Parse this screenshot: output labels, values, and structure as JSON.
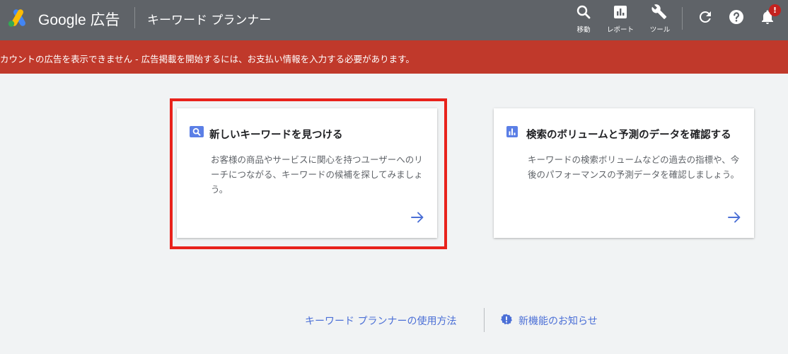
{
  "header": {
    "brand": "Google 広告",
    "page_title": "キーワード プランナー",
    "tools": [
      {
        "label": "移動",
        "icon": "search-icon"
      },
      {
        "label": "レポート",
        "icon": "report-icon"
      },
      {
        "label": "ツール",
        "icon": "wrench-icon"
      }
    ],
    "notification_badge": "!"
  },
  "alert": {
    "text": "カウントの広告を表示できません - 広告掲載を開始するには、お支払い情報を入力する必要があります。"
  },
  "cards": [
    {
      "title": "新しいキーワードを見つける",
      "description": "お客様の商品やサービスに関心を持つユーザーへのリーチにつながる、キーワードの候補を探してみましょう。",
      "icon": "search-icon"
    },
    {
      "title": "検索のボリュームと予測のデータを確認する",
      "description": "キーワードの検索ボリュームなどの過去の指標や、今後のパフォーマンスの予測データを確認しましょう。",
      "icon": "bar-chart-icon"
    }
  ],
  "footer": {
    "how_to": "キーワード プランナーの使用方法",
    "news": "新機能のお知らせ"
  },
  "colors": {
    "header": "#5f6368",
    "alert": "#c0392b",
    "accent": "#4b6fd6",
    "highlight": "#e8221b",
    "background": "#f1f3f4"
  }
}
